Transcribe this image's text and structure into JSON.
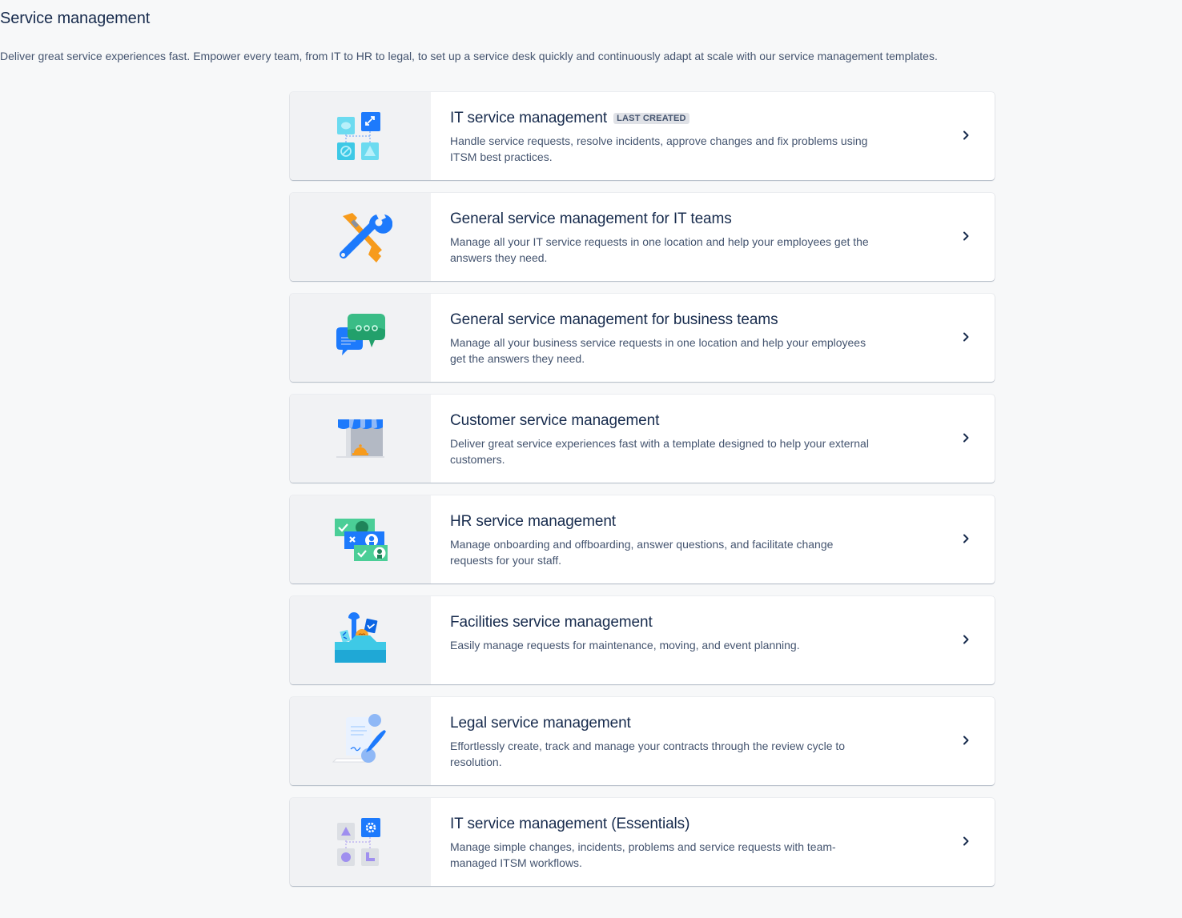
{
  "header": {
    "title": "Service management",
    "description": "Deliver great service experiences fast. Empower every team, from IT to HR to legal, to set up a service desk quickly and continuously adapt at scale with our service management templates."
  },
  "templates": [
    {
      "title": "IT service management",
      "badge": "LAST CREATED",
      "description": "Handle service requests, resolve incidents, approve changes and fix problems using ITSM best practices.",
      "icon": "itsm-diagram-icon"
    },
    {
      "title": "General service management for IT teams",
      "description": "Manage all your IT service requests in one location and help your employees get the answers they need.",
      "icon": "tools-icon"
    },
    {
      "title": "General service management for business teams",
      "description": "Manage all your business service requests in one location and help your employees get the answers they need.",
      "icon": "chat-bubbles-icon"
    },
    {
      "title": "Customer service management",
      "description": "Deliver great service experiences fast with a template designed to help your external customers.",
      "icon": "storefront-bell-icon"
    },
    {
      "title": "HR service management",
      "description": "Manage onboarding and offboarding, answer questions, and facilitate change requests for your staff.",
      "icon": "people-cards-icon"
    },
    {
      "title": "Facilities service management",
      "description": "Easily manage requests for maintenance, moving, and event planning.",
      "icon": "toolbox-icon"
    },
    {
      "title": "Legal service management",
      "description": "Effortlessly create, track and manage your contracts through the review cycle to resolution.",
      "icon": "contract-scroll-icon"
    },
    {
      "title": "IT service management (Essentials)",
      "description": "Manage simple changes, incidents, problems and service requests with team-managed ITSM workflows.",
      "icon": "itsm-essentials-diagram-icon"
    }
  ],
  "colors": {
    "page_background": "#f7f8f9",
    "card_background": "#ffffff",
    "illustration_background": "#f1f2f4",
    "text_primary": "#172b4d",
    "text_secondary": "#44546f",
    "lozenge_background": "#dfe1e6"
  }
}
